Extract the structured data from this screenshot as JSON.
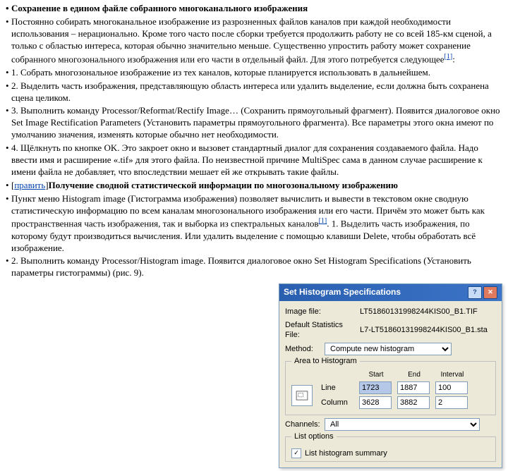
{
  "heading1": "Сохранение в едином файле собранного многоканального изображения",
  "para1": "Постоянно собирать многоканальное изображение из разрозненных файлов каналов при каждой необходимости использования – нерационально. Кроме того часто после сборки требуется продолжить работу не со всей 185-км сценой, а только с областью интереса, которая обычно значительно меньше. Существенно упростить работу может сохранение собранного многозонального изображения или его части в отдельный файл. Для этого потребуется следующее",
  "para1_ref": "[1]",
  "para1_tail": ":",
  "step1": "1. Собрать многозональное изображение из тех каналов, которые планируется использовать в дальнейшем.",
  "step2": "2. Выделить часть изображения, представляющую область интереса или удалить выделение, если должна быть сохранена сцена целиком.",
  "step3": "3. Выполнить команду Processor/Reformat/Rectify Image… (Сохранить прямоугольный фрагмент). Появится диалоговое окно Set Image Rectification Parameters (Установить параметры прямоугольного фрагмента). Все параметры этого окна имеют по умолчанию значения, изменять которые обычно нет необходимости.",
  "step4": "4. Щёлкнуть по кнопке OK. Это закроет окно и вызовет стандартный диалог для сохранения создаваемого файла. Надо ввести имя и расширение «.tif» для этого файла. По неизвестной причине MultiSpec сама в данном случае расширение к имени файла не добавляет, что впоследствии мешает ей же открывать такие файлы.",
  "edit_label": "править",
  "heading2": "Получение сводной статистической информации по многозональному изображению",
  "para2a": "Пункт меню Histogram image (Гистограмма изображения) позволяет вычислить и вывести в текстовом окне сводную статистическую информацию по всем каналам многозонального изображения или его части. Причём это может быть как пространственная часть изображения, так и выборка из спектральных каналов",
  "para2_ref": "[1]",
  "para2b": ". 1. Выделить часть изображения, по которому будут производиться вычисления. Или удалить выделение с помощью клавиши Delete, чтобы обработать всё изображение.",
  "step2b": "2. Выполнить команду Processor/Histogram image. Появится диалоговое окно Set Histogram Specifications (Установить параметры гистограммы) (рис. 9).",
  "dialog": {
    "title": "Set Histogram Specifications",
    "imagefile_label": "Image file:",
    "imagefile_value": "LT51860131998244KIS00_B1.TIF",
    "statfile_label": "Default Statistics File:",
    "statfile_value": "L7-LT51860131998244KIS00_B1.sta",
    "method_label": "Method:",
    "method_value": "Compute new histogram",
    "area_group": "Area to Histogram",
    "hdr_start": "Start",
    "hdr_end": "End",
    "hdr_interval": "Interval",
    "line_label": "Line",
    "line_start": "1723",
    "line_end": "1887",
    "line_interval": "100",
    "col_label": "Column",
    "col_start": "3628",
    "col_end": "3882",
    "col_interval": "2",
    "channels_label": "Channels:",
    "channels_value": "All",
    "listopt_group": "List options",
    "list_hist_summary": "List histogram summary"
  }
}
